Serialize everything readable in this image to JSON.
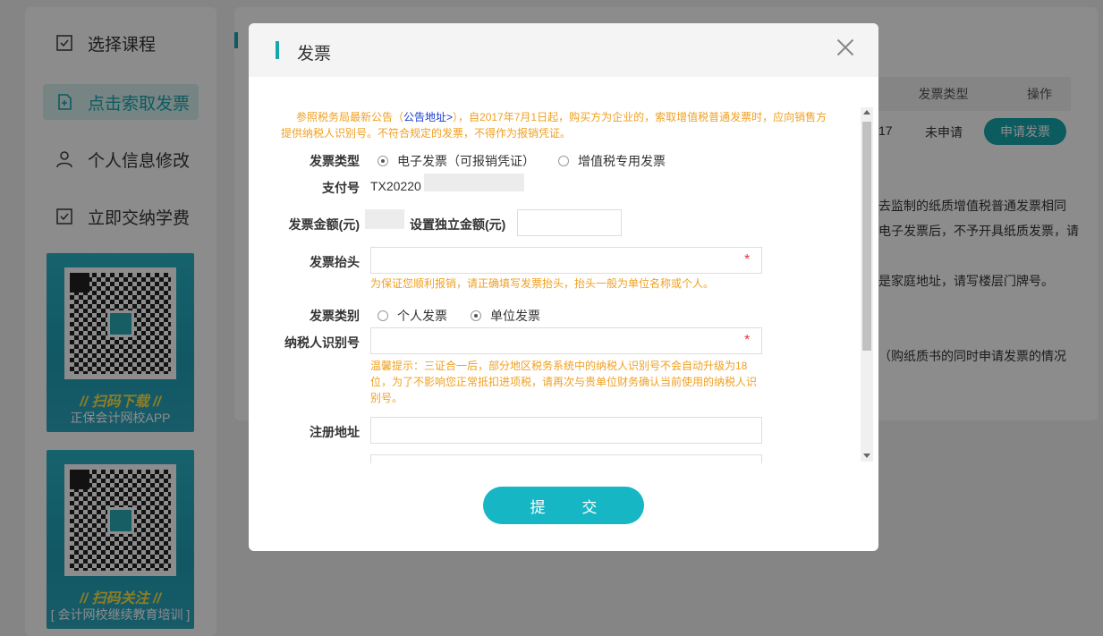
{
  "sidebar": {
    "items": [
      {
        "label": "选择课程",
        "icon": "checkbox-icon"
      },
      {
        "label": "点击索取发票",
        "icon": "invoice-add-icon"
      },
      {
        "label": "个人信息修改",
        "icon": "user-icon"
      },
      {
        "label": "立即交纳学费",
        "icon": "checkbox-icon"
      }
    ],
    "qr_cards": [
      {
        "title": "// 扫码下载 //",
        "subtitle": "正保会计网校APP"
      },
      {
        "title": "// 扫码关注 //",
        "subtitle": "[ 会计网校继续教育培训 ]"
      }
    ]
  },
  "background": {
    "table": {
      "headers": [
        "发票类型",
        "操作"
      ],
      "row": {
        "partial_id": "17",
        "status": "未申请",
        "action_label": "申请发票"
      }
    },
    "text_fragments": [
      "去监制的纸质增值税普通发票相同",
      "电子发票后，不予开具纸质发票，请",
      "是家庭地址，请写楼层门牌号。",
      "（购纸质书的同时申请发票的情况"
    ]
  },
  "modal": {
    "title": "发票",
    "notice": {
      "before_link": "参照税务局最新公告（",
      "link_text": "公告地址>",
      "after_link": "），自2017年7月1日起，购买方为企业的，索取增值税普通发票时，应向销售方提供纳税人识别号。不符合规定的发票，不得作为报销凭证。"
    },
    "invoice_type": {
      "label": "发票类型",
      "options": [
        "电子发票（可报销凭证）",
        "增值税专用发票"
      ],
      "selected": 0
    },
    "payment_no": {
      "label": "支付号",
      "value": "TX20220"
    },
    "amount": {
      "label": "发票金额(元)",
      "custom_label": "设置独立金额(元)",
      "custom_value": ""
    },
    "header_field": {
      "label": "发票抬头",
      "value": "",
      "required_mark": "*",
      "hint": "为保证您顺利报销，请正确填写发票抬头，抬头一般为单位名称或个人。"
    },
    "category": {
      "label": "发票类别",
      "options": [
        "个人发票",
        "单位发票"
      ],
      "selected": 1
    },
    "tax_id": {
      "label": "纳税人识别号",
      "value": "",
      "required_mark": "*",
      "hint": "温馨提示：三证合一后，部分地区税务系统中的纳税人识别号不会自动升级为18位，为了不影响您正常抵扣进项税，请再次与贵单位财务确认当前使用的纳税人识别号。"
    },
    "address": {
      "label": "注册地址",
      "value": ""
    },
    "submit_label": "提 交"
  }
}
